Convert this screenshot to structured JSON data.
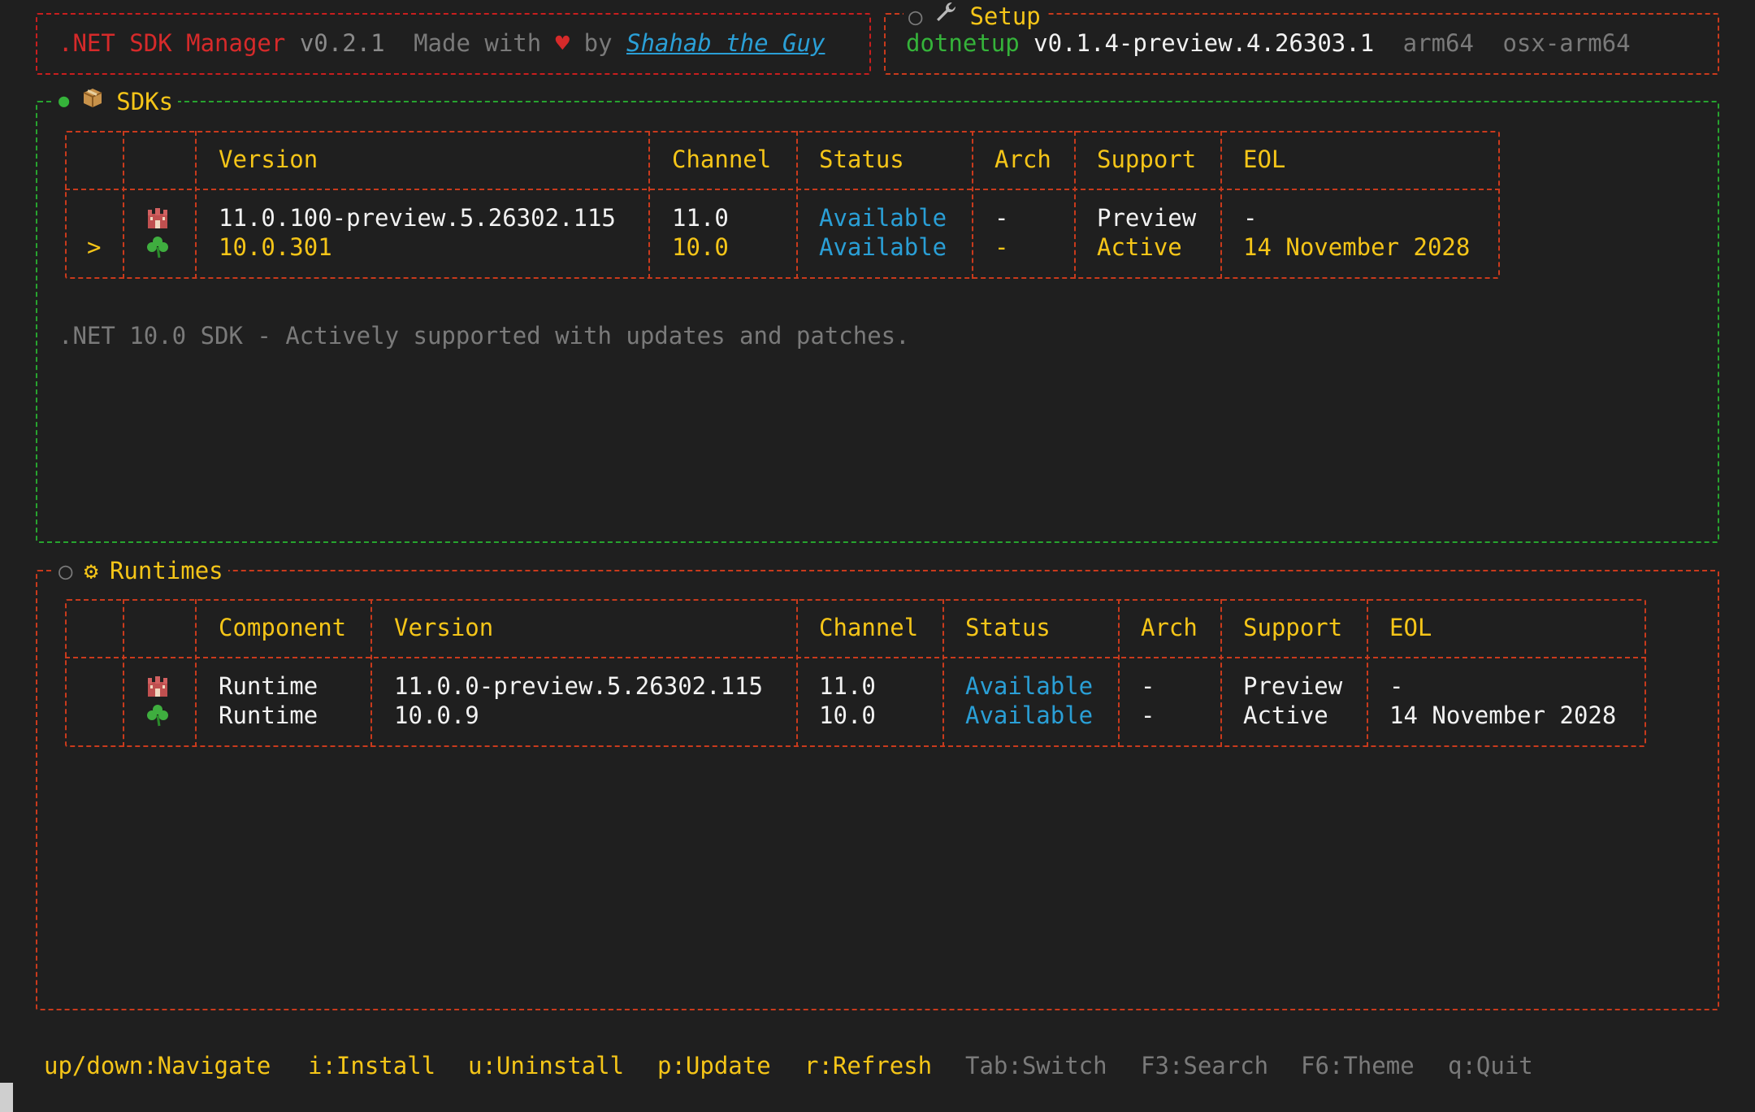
{
  "header": {
    "app_name": ".NET SDK Manager",
    "version": "v0.2.1",
    "made_with": "Made with",
    "by": "by",
    "author": "Shahab the Guy",
    "colors": {
      "app_name": "#d62a2a",
      "heart": "#d62a2a",
      "link": "#2a9fd6"
    }
  },
  "setup": {
    "title": "Setup",
    "tool": "dotnetup",
    "tool_version": "v0.1.4-preview.4.26303.1",
    "arch": "arm64",
    "rid": "osx-arm64"
  },
  "sdks": {
    "title": "SDKs",
    "columns": [
      "Version",
      "Channel",
      "Status",
      "Arch",
      "Support",
      "EOL"
    ],
    "rows": [
      {
        "marker": "",
        "icon": "castle-icon",
        "version": "11.0.100-preview.5.26302.115",
        "channel": "11.0",
        "status": "Available",
        "arch": "-",
        "support": "Preview",
        "eol": "-"
      },
      {
        "marker": ">",
        "icon": "clover-icon",
        "version": "10.0.301",
        "channel": "10.0",
        "status": "Available",
        "arch": "-",
        "support": "Active",
        "eol": "14 November 2028"
      }
    ],
    "description": ".NET 10.0 SDK - Actively supported with updates and patches."
  },
  "runtimes": {
    "title": "Runtimes",
    "columns": [
      "Component",
      "Version",
      "Channel",
      "Status",
      "Arch",
      "Support",
      "EOL"
    ],
    "rows": [
      {
        "icon": "castle-icon",
        "component": "Runtime",
        "version": "11.0.0-preview.5.26302.115",
        "channel": "11.0",
        "status": "Available",
        "arch": "-",
        "support": "Preview",
        "eol": "-"
      },
      {
        "icon": "clover-icon",
        "component": "Runtime",
        "version": "10.0.9",
        "channel": "10.0",
        "status": "Available",
        "arch": "-",
        "support": "Active",
        "eol": "14 November 2028"
      }
    ]
  },
  "footer": {
    "active_keys": [
      "up/down:Navigate",
      "i:Install",
      "u:Uninstall",
      "p:Update",
      "r:Refresh"
    ],
    "inactive_keys": [
      "Tab:Switch",
      "F3:Search",
      "F6:Theme",
      "q:Quit"
    ]
  },
  "colors": {
    "background": "#1f1f1f",
    "accent_yellow": "#f5c518",
    "panel_active_border": "#27a32f",
    "panel_border": "#c93a1c",
    "status_available": "#2a9fd6"
  }
}
